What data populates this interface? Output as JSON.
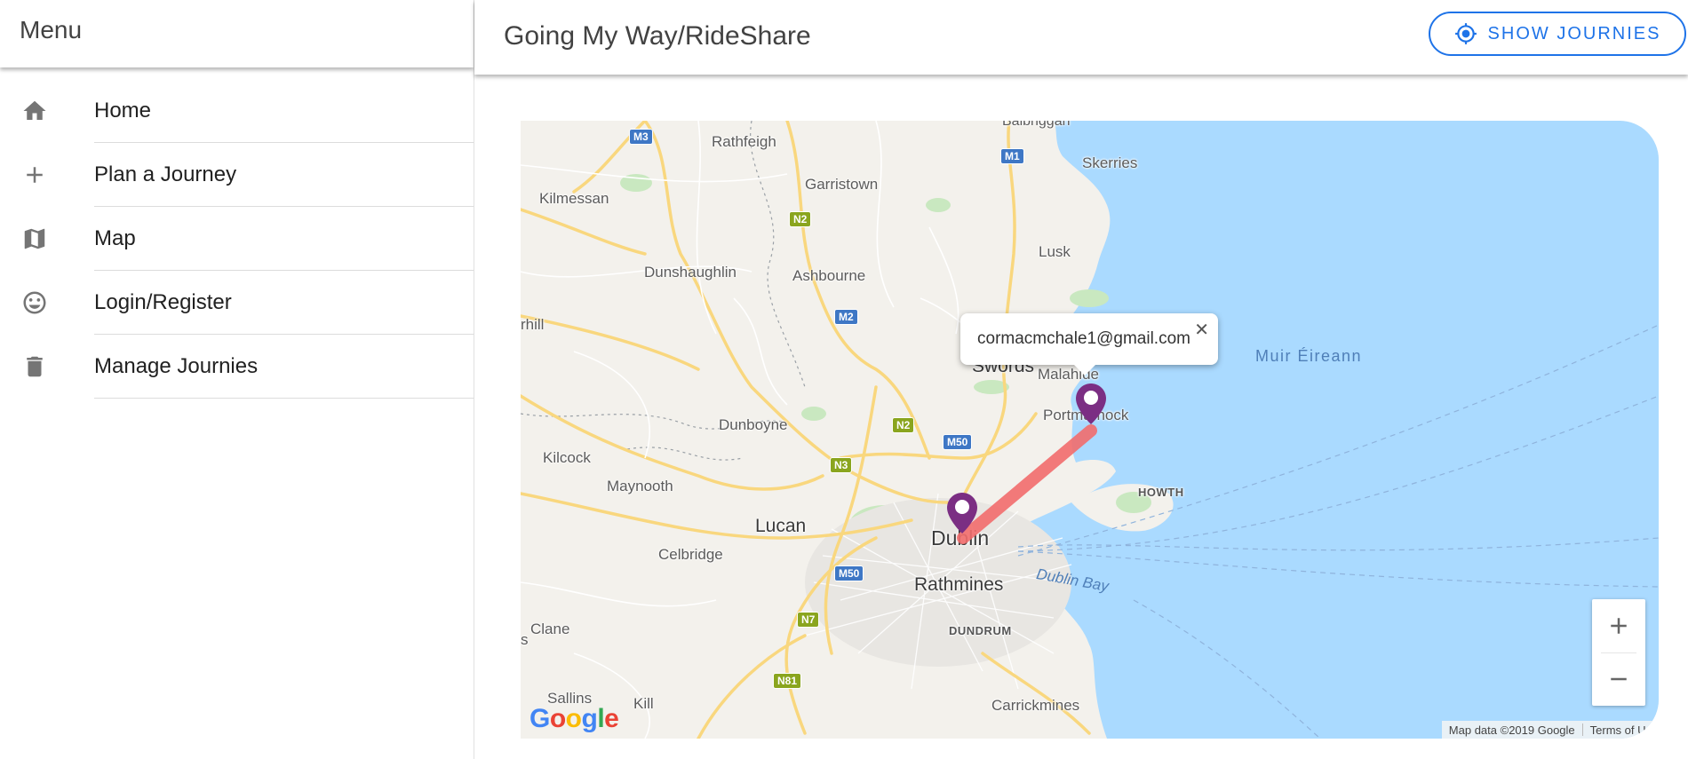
{
  "sidebar": {
    "title": "Menu",
    "items": [
      {
        "label": "Home",
        "icon": "home-icon"
      },
      {
        "label": "Plan a Journey",
        "icon": "plus-icon"
      },
      {
        "label": "Map",
        "icon": "map-icon"
      },
      {
        "label": "Login/Register",
        "icon": "smiley-icon"
      },
      {
        "label": "Manage Journies",
        "icon": "trash-icon"
      }
    ]
  },
  "header": {
    "title": "Going My Way/RideShare",
    "show_button_label": "SHOW JOURNIES",
    "accent_color": "#1e73e8"
  },
  "map": {
    "popup_text": "cormacmchale1@gmail.com",
    "popup_close": "✕",
    "places": {
      "balbriggan": "Balbriggan",
      "rathfeigh": "Rathfeigh",
      "skerries": "Skerries",
      "kilmessan": "Kilmessan",
      "garristown": "Garristown",
      "lusk": "Lusk",
      "dunshaughlin": "Dunshaughlin",
      "ashbourne": "Ashbourne",
      "hill": "rhill",
      "swords": "Swords",
      "malahide": "Malahide",
      "muir_eireann": "Muir Éireann",
      "portmarnock": "Portmarnock",
      "dunboyne": "Dunboyne",
      "kilcock": "Kilcock",
      "maynooth": "Maynooth",
      "howth": "HOWTH",
      "lucan": "Lucan",
      "dublin": "Dublin",
      "celbridge": "Celbridge",
      "rathmines": "Rathmines",
      "dublin_bay": "Dublin Bay",
      "clane": "Clane",
      "s": "s",
      "dundrum": "DUNDRUM",
      "sallins": "Sallins",
      "kill": "Kill",
      "carrickmines": "Carrickmines"
    },
    "roads": {
      "m3": "M3",
      "m1": "M1",
      "n2a": "N2",
      "m2": "M2",
      "n2b": "N2",
      "m50a": "M50",
      "n3": "N3",
      "m50b": "M50",
      "n7": "N7",
      "n81": "N81"
    },
    "marker_color": "#7b2e83",
    "route_color": "#f26d6d",
    "attribution": "Map data ©2019 Google",
    "terms": "Terms of Us",
    "logo_letters": [
      "G",
      "o",
      "o",
      "g",
      "l",
      "e"
    ]
  }
}
